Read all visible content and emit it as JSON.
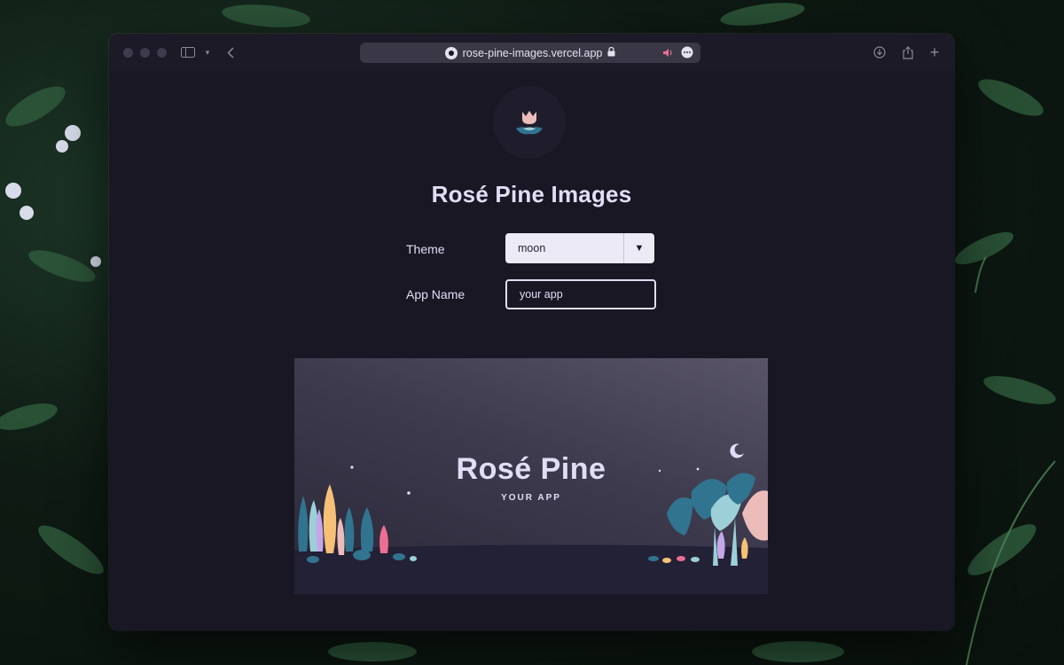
{
  "browser": {
    "url": "rose-pine-images.vercel.app",
    "lock_icon": "lock-icon",
    "sound_icon": "speaker-icon",
    "more_icon": "more-icon"
  },
  "page": {
    "title": "Rosé Pine Images",
    "logo_icon": "rose-pine-logo"
  },
  "form": {
    "theme_label": "Theme",
    "theme_value": "moon",
    "app_name_label": "App Name",
    "app_name_value": "your app"
  },
  "preview": {
    "title": "Rosé Pine",
    "subtitle": "YOUR APP"
  },
  "colors": {
    "base": "#191724",
    "text": "#e0def4",
    "foam": "#9ccfd8",
    "pine": "#31748f",
    "gold": "#f6c177",
    "rose": "#ebbcba",
    "love": "#eb6f92",
    "iris": "#c4a7e7"
  }
}
